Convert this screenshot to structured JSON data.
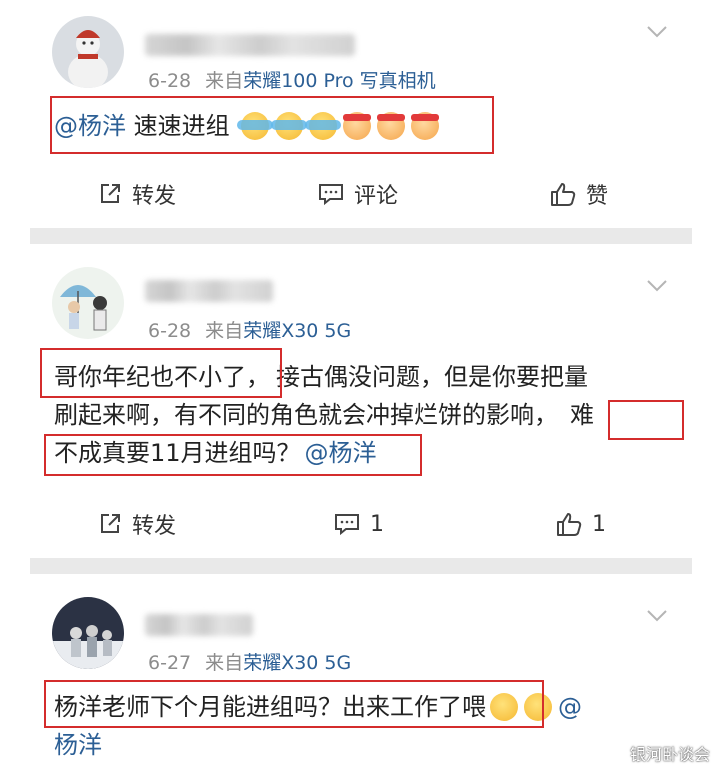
{
  "posts": [
    {
      "date": "6-28",
      "source_prefix": "来自",
      "device": "荣耀100 Pro 写真相机",
      "text_mention": "@杨洋",
      "text_body": " 速速进组",
      "actions": {
        "repost": "转发",
        "comment": "评论",
        "like": "赞"
      }
    },
    {
      "date": "6-28",
      "source_prefix": "来自",
      "device": "荣耀X30 5G",
      "line1_a": "哥你年纪也不小了，",
      "line1_b": "接古偶没问题，但是你要把量",
      "line2_a": "刷起来啊，有不同的角色就会冲掉烂饼的影响，",
      "line2_b": "难",
      "line3_a": "不成真要11月进组吗？",
      "line3_mention": "@杨洋",
      "actions": {
        "repost": "转发",
        "comment": "1",
        "like": "1"
      }
    },
    {
      "date": "6-27",
      "source_prefix": "来自",
      "device": "荣耀X30 5G",
      "line1_a": "杨洋老师下个月能进组吗？出来工作了喂",
      "line1_mention": "@",
      "line2_mention": "杨洋"
    }
  ],
  "watermark": "银河卧谈会",
  "colors": {
    "link": "#2c5f95",
    "highlight_box": "#d42c2c",
    "meta": "#8c8c8c",
    "separator": "#e9e9e9"
  },
  "icons": [
    "chevron-down-icon",
    "repost-icon",
    "comment-icon",
    "like-icon",
    "emoji-crying-icon",
    "emoji-headband-icon",
    "emoji-smile-icon"
  ]
}
